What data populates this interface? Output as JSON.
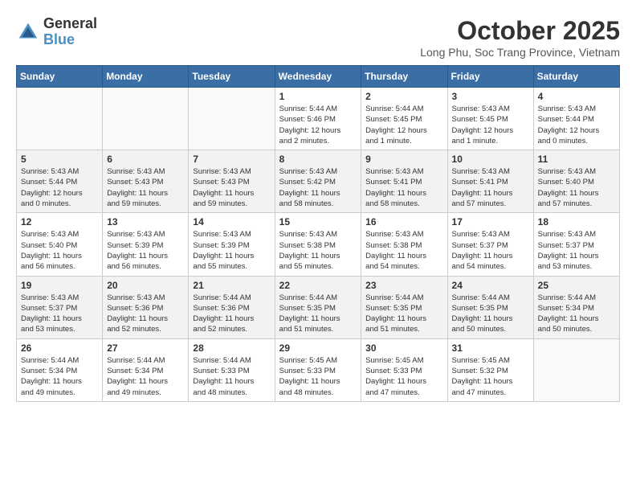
{
  "logo": {
    "general": "General",
    "blue": "Blue"
  },
  "title": {
    "month_year": "October 2025",
    "location": "Long Phu, Soc Trang Province, Vietnam"
  },
  "weekdays": [
    "Sunday",
    "Monday",
    "Tuesday",
    "Wednesday",
    "Thursday",
    "Friday",
    "Saturday"
  ],
  "weeks": [
    [
      {
        "day": "",
        "info": ""
      },
      {
        "day": "",
        "info": ""
      },
      {
        "day": "",
        "info": ""
      },
      {
        "day": "1",
        "info": "Sunrise: 5:44 AM\nSunset: 5:46 PM\nDaylight: 12 hours\nand 2 minutes."
      },
      {
        "day": "2",
        "info": "Sunrise: 5:44 AM\nSunset: 5:45 PM\nDaylight: 12 hours\nand 1 minute."
      },
      {
        "day": "3",
        "info": "Sunrise: 5:43 AM\nSunset: 5:45 PM\nDaylight: 12 hours\nand 1 minute."
      },
      {
        "day": "4",
        "info": "Sunrise: 5:43 AM\nSunset: 5:44 PM\nDaylight: 12 hours\nand 0 minutes."
      }
    ],
    [
      {
        "day": "5",
        "info": "Sunrise: 5:43 AM\nSunset: 5:44 PM\nDaylight: 12 hours\nand 0 minutes."
      },
      {
        "day": "6",
        "info": "Sunrise: 5:43 AM\nSunset: 5:43 PM\nDaylight: 11 hours\nand 59 minutes."
      },
      {
        "day": "7",
        "info": "Sunrise: 5:43 AM\nSunset: 5:43 PM\nDaylight: 11 hours\nand 59 minutes."
      },
      {
        "day": "8",
        "info": "Sunrise: 5:43 AM\nSunset: 5:42 PM\nDaylight: 11 hours\nand 58 minutes."
      },
      {
        "day": "9",
        "info": "Sunrise: 5:43 AM\nSunset: 5:41 PM\nDaylight: 11 hours\nand 58 minutes."
      },
      {
        "day": "10",
        "info": "Sunrise: 5:43 AM\nSunset: 5:41 PM\nDaylight: 11 hours\nand 57 minutes."
      },
      {
        "day": "11",
        "info": "Sunrise: 5:43 AM\nSunset: 5:40 PM\nDaylight: 11 hours\nand 57 minutes."
      }
    ],
    [
      {
        "day": "12",
        "info": "Sunrise: 5:43 AM\nSunset: 5:40 PM\nDaylight: 11 hours\nand 56 minutes."
      },
      {
        "day": "13",
        "info": "Sunrise: 5:43 AM\nSunset: 5:39 PM\nDaylight: 11 hours\nand 56 minutes."
      },
      {
        "day": "14",
        "info": "Sunrise: 5:43 AM\nSunset: 5:39 PM\nDaylight: 11 hours\nand 55 minutes."
      },
      {
        "day": "15",
        "info": "Sunrise: 5:43 AM\nSunset: 5:38 PM\nDaylight: 11 hours\nand 55 minutes."
      },
      {
        "day": "16",
        "info": "Sunrise: 5:43 AM\nSunset: 5:38 PM\nDaylight: 11 hours\nand 54 minutes."
      },
      {
        "day": "17",
        "info": "Sunrise: 5:43 AM\nSunset: 5:37 PM\nDaylight: 11 hours\nand 54 minutes."
      },
      {
        "day": "18",
        "info": "Sunrise: 5:43 AM\nSunset: 5:37 PM\nDaylight: 11 hours\nand 53 minutes."
      }
    ],
    [
      {
        "day": "19",
        "info": "Sunrise: 5:43 AM\nSunset: 5:37 PM\nDaylight: 11 hours\nand 53 minutes."
      },
      {
        "day": "20",
        "info": "Sunrise: 5:43 AM\nSunset: 5:36 PM\nDaylight: 11 hours\nand 52 minutes."
      },
      {
        "day": "21",
        "info": "Sunrise: 5:44 AM\nSunset: 5:36 PM\nDaylight: 11 hours\nand 52 minutes."
      },
      {
        "day": "22",
        "info": "Sunrise: 5:44 AM\nSunset: 5:35 PM\nDaylight: 11 hours\nand 51 minutes."
      },
      {
        "day": "23",
        "info": "Sunrise: 5:44 AM\nSunset: 5:35 PM\nDaylight: 11 hours\nand 51 minutes."
      },
      {
        "day": "24",
        "info": "Sunrise: 5:44 AM\nSunset: 5:35 PM\nDaylight: 11 hours\nand 50 minutes."
      },
      {
        "day": "25",
        "info": "Sunrise: 5:44 AM\nSunset: 5:34 PM\nDaylight: 11 hours\nand 50 minutes."
      }
    ],
    [
      {
        "day": "26",
        "info": "Sunrise: 5:44 AM\nSunset: 5:34 PM\nDaylight: 11 hours\nand 49 minutes."
      },
      {
        "day": "27",
        "info": "Sunrise: 5:44 AM\nSunset: 5:34 PM\nDaylight: 11 hours\nand 49 minutes."
      },
      {
        "day": "28",
        "info": "Sunrise: 5:44 AM\nSunset: 5:33 PM\nDaylight: 11 hours\nand 48 minutes."
      },
      {
        "day": "29",
        "info": "Sunrise: 5:45 AM\nSunset: 5:33 PM\nDaylight: 11 hours\nand 48 minutes."
      },
      {
        "day": "30",
        "info": "Sunrise: 5:45 AM\nSunset: 5:33 PM\nDaylight: 11 hours\nand 47 minutes."
      },
      {
        "day": "31",
        "info": "Sunrise: 5:45 AM\nSunset: 5:32 PM\nDaylight: 11 hours\nand 47 minutes."
      },
      {
        "day": "",
        "info": ""
      }
    ]
  ]
}
